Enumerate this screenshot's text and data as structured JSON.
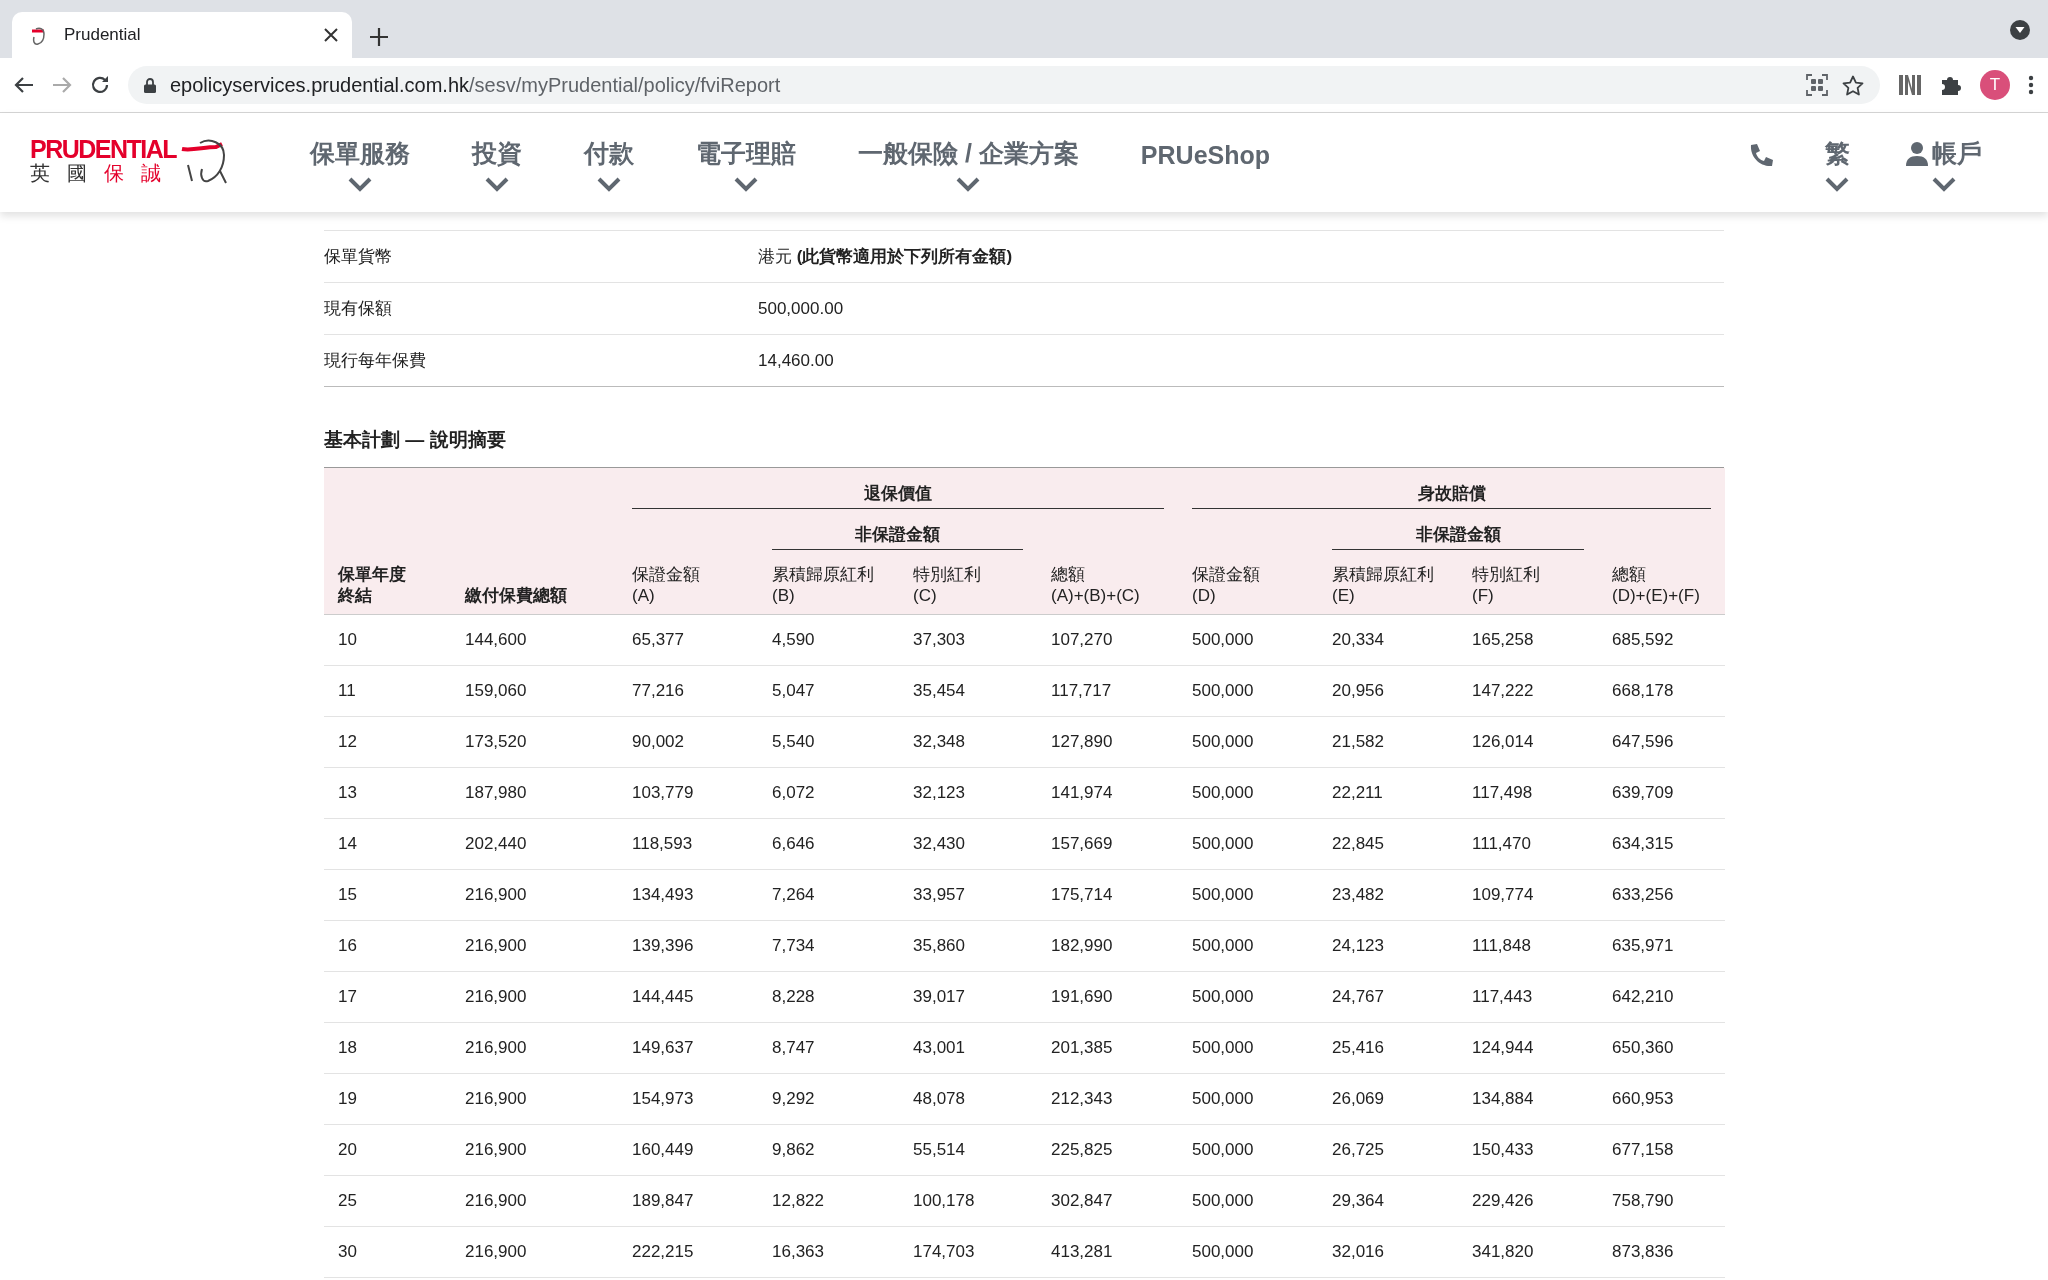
{
  "browser": {
    "tab_title": "Prudential",
    "url_host": "epolicyservices.prudential.com.hk",
    "url_path": "/sesv/myPrudential/policy/fviReport",
    "profile_initial": "T"
  },
  "site_header": {
    "logo": {
      "wordmark": "PRUDENTIAL",
      "chinese": [
        {
          "text": "英",
          "color": "#333333"
        },
        {
          "text": "國",
          "color": "#333333"
        },
        {
          "text": "保",
          "color": "#e4002b"
        },
        {
          "text": "誠",
          "color": "#e4002b"
        }
      ]
    },
    "nav": [
      {
        "label": "保單服務",
        "has_menu": true
      },
      {
        "label": "投資",
        "has_menu": true
      },
      {
        "label": "付款",
        "has_menu": true
      },
      {
        "label": "電子理賠",
        "has_menu": true
      },
      {
        "label": "一般保險 / 企業方案",
        "has_menu": true
      },
      {
        "label": "PRUeShop",
        "has_menu": false
      }
    ],
    "language": "繁",
    "account": "帳戶"
  },
  "policy_info": [
    {
      "label": "保單貨幣",
      "value": "港元 **(此貨幣適用於下列所有金額)**"
    },
    {
      "label": "現有保額",
      "value": "500,000.00"
    },
    {
      "label": "現行每年保費",
      "value": "14,460.00"
    }
  ],
  "summary": {
    "title": "基本計劃 — 說明摘要",
    "groups": [
      {
        "label": "退保價值",
        "sub": "非保證金額"
      },
      {
        "label": "身故賠償",
        "sub": "非保證金額"
      }
    ],
    "columns": [
      "保單年度終結",
      "繳付保費總額",
      "保證金額\n(A)",
      "累積歸原紅利\n(B)",
      "特別紅利\n(C)",
      "總額\n(A)+(B)+(C)",
      "保證金額\n(D)",
      "累積歸原紅利\n(E)",
      "特別紅利\n(F)",
      "總額\n(D)+(E)+(F)"
    ],
    "rows": [
      [
        "10",
        "144,600",
        "65,377",
        "4,590",
        "37,303",
        "107,270",
        "500,000",
        "20,334",
        "165,258",
        "685,592"
      ],
      [
        "11",
        "159,060",
        "77,216",
        "5,047",
        "35,454",
        "117,717",
        "500,000",
        "20,956",
        "147,222",
        "668,178"
      ],
      [
        "12",
        "173,520",
        "90,002",
        "5,540",
        "32,348",
        "127,890",
        "500,000",
        "21,582",
        "126,014",
        "647,596"
      ],
      [
        "13",
        "187,980",
        "103,779",
        "6,072",
        "32,123",
        "141,974",
        "500,000",
        "22,211",
        "117,498",
        "639,709"
      ],
      [
        "14",
        "202,440",
        "118,593",
        "6,646",
        "32,430",
        "157,669",
        "500,000",
        "22,845",
        "111,470",
        "634,315"
      ],
      [
        "15",
        "216,900",
        "134,493",
        "7,264",
        "33,957",
        "175,714",
        "500,000",
        "23,482",
        "109,774",
        "633,256"
      ],
      [
        "16",
        "216,900",
        "139,396",
        "7,734",
        "35,860",
        "182,990",
        "500,000",
        "24,123",
        "111,848",
        "635,971"
      ],
      [
        "17",
        "216,900",
        "144,445",
        "8,228",
        "39,017",
        "191,690",
        "500,000",
        "24,767",
        "117,443",
        "642,210"
      ],
      [
        "18",
        "216,900",
        "149,637",
        "8,747",
        "43,001",
        "201,385",
        "500,000",
        "25,416",
        "124,944",
        "650,360"
      ],
      [
        "19",
        "216,900",
        "154,973",
        "9,292",
        "48,078",
        "212,343",
        "500,000",
        "26,069",
        "134,884",
        "660,953"
      ],
      [
        "20",
        "216,900",
        "160,449",
        "9,862",
        "55,514",
        "225,825",
        "500,000",
        "26,725",
        "150,433",
        "677,158"
      ],
      [
        "25",
        "216,900",
        "189,847",
        "12,822",
        "100,178",
        "302,847",
        "500,000",
        "29,364",
        "229,426",
        "758,790"
      ],
      [
        "30",
        "216,900",
        "222,215",
        "16,363",
        "174,703",
        "413,281",
        "500,000",
        "32,016",
        "341,820",
        "873,836"
      ]
    ]
  }
}
